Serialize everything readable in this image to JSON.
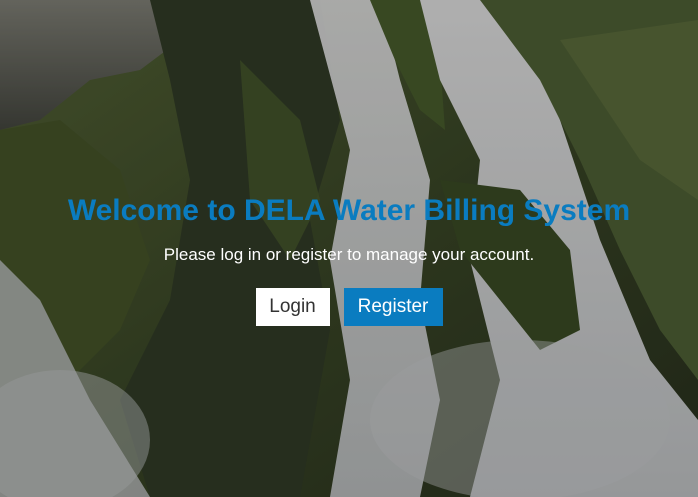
{
  "hero": {
    "title": "Welcome to DELA Water Billing System",
    "subtitle": "Please log in or register to manage your account."
  },
  "actions": {
    "login_label": "Login",
    "register_label": "Register"
  },
  "colors": {
    "accent": "#0a7cc0",
    "login_bg": "#ffffff",
    "subtitle_text": "#ffffff"
  }
}
